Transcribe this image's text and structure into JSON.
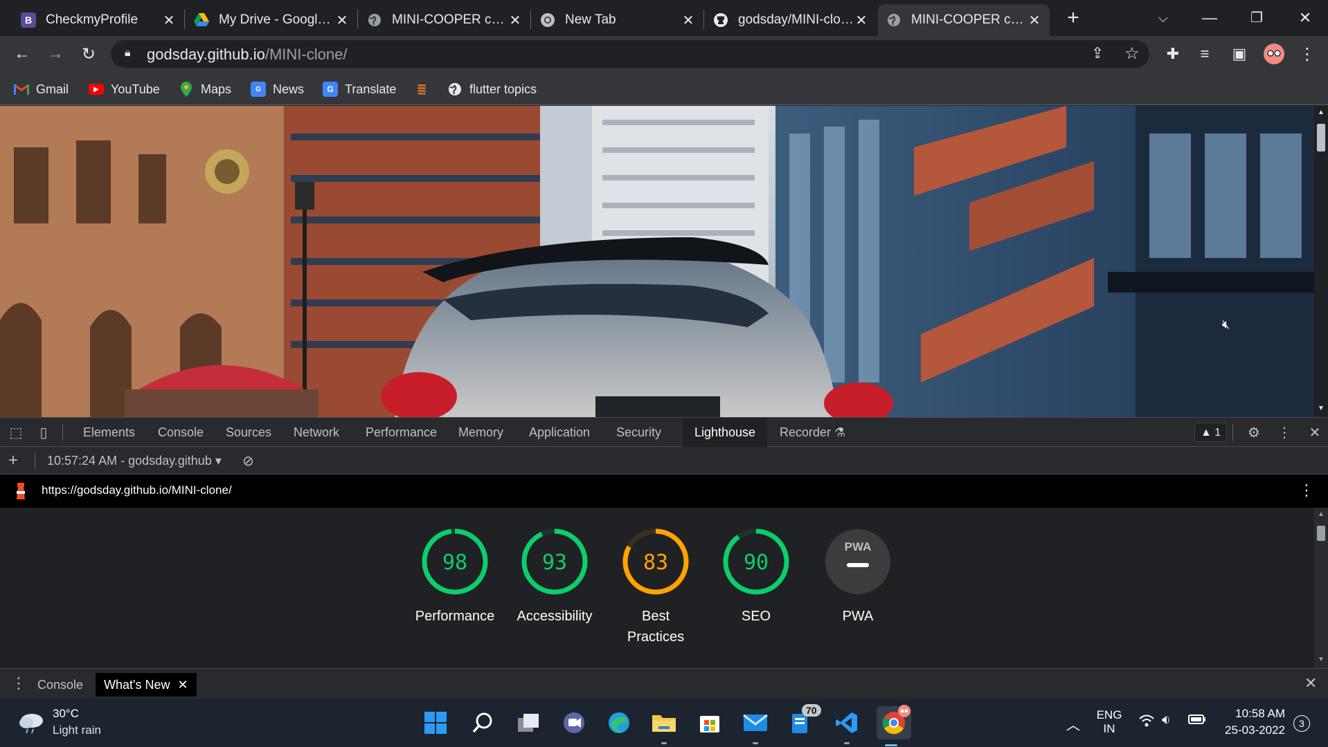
{
  "browser": {
    "tabs": [
      {
        "title": "CheckmyProfile",
        "icon": "b-logo-icon",
        "active": false
      },
      {
        "title": "My Drive - Google Drive",
        "icon": "google-drive-icon",
        "active": false
      },
      {
        "title": "MINI-COOPER configurator",
        "icon": "globe-icon",
        "active": false
      },
      {
        "title": "New Tab",
        "icon": "chrome-icon",
        "active": false
      },
      {
        "title": "godsday/MINI-clone",
        "icon": "github-icon",
        "active": false
      },
      {
        "title": "MINI-COOPER configurator",
        "icon": "globe-icon",
        "active": true
      }
    ],
    "new_tab_label": "+",
    "address": {
      "host": "godsday.github.io",
      "path": "/MINI-clone/"
    },
    "bookmarks": [
      {
        "label": "Gmail",
        "icon": "gmail-icon"
      },
      {
        "label": "YouTube",
        "icon": "youtube-icon"
      },
      {
        "label": "Maps",
        "icon": "maps-icon"
      },
      {
        "label": "News",
        "icon": "news-icon"
      },
      {
        "label": "Translate",
        "icon": "translate-icon"
      },
      {
        "label": "",
        "icon": "stack-icon"
      },
      {
        "label": "flutter topics",
        "icon": "globe-icon"
      }
    ]
  },
  "devtools": {
    "tabs": [
      "Elements",
      "Console",
      "Sources",
      "Network",
      "Performance",
      "Memory",
      "Application",
      "Security",
      "Lighthouse",
      "Recorder"
    ],
    "active_tab": "Lighthouse",
    "issues_count": "1",
    "report_selector": "10:57:24 AM - godsday.github",
    "report_url": "https://godsday.github.io/MINI-clone/",
    "scores": [
      {
        "label_line1": "Performance",
        "label_line2": "",
        "score": "98",
        "value": 98,
        "color": "#0cce6b",
        "pwa": false
      },
      {
        "label_line1": "Accessibility",
        "label_line2": "",
        "score": "93",
        "value": 93,
        "color": "#0cce6b",
        "pwa": false
      },
      {
        "label_line1": "Best",
        "label_line2": "Practices",
        "score": "83",
        "value": 83,
        "color": "#ffa400",
        "pwa": false
      },
      {
        "label_line1": "SEO",
        "label_line2": "",
        "score": "90",
        "value": 90,
        "color": "#0cce6b",
        "pwa": false
      },
      {
        "label_line1": "PWA",
        "label_line2": "",
        "score": "",
        "value": 0,
        "color": "#9aa0a6",
        "pwa": true,
        "badge_text": "PWA"
      }
    ],
    "drawer_tabs": [
      "Console",
      "What's New"
    ],
    "drawer_active": "What's New"
  },
  "taskbar": {
    "weather": {
      "temp": "30°C",
      "desc": "Light rain"
    },
    "apps": [
      {
        "name": "start-icon",
        "running": false
      },
      {
        "name": "search-icon",
        "running": false
      },
      {
        "name": "task-view-icon",
        "running": false
      },
      {
        "name": "teams-chat-icon",
        "running": false
      },
      {
        "name": "edge-icon",
        "running": false
      },
      {
        "name": "file-explorer-icon",
        "running": true
      },
      {
        "name": "microsoft-store-icon",
        "running": false
      },
      {
        "name": "mail-icon",
        "running": true
      },
      {
        "name": "todo-icon",
        "running": false,
        "badge": "70"
      },
      {
        "name": "vscode-icon",
        "running": true
      },
      {
        "name": "chrome-icon",
        "running": true,
        "focused": true
      }
    ],
    "lang_line1": "ENG",
    "lang_line2": "IN",
    "time": "10:58 AM",
    "date": "25-03-2022",
    "notification_count": "3"
  },
  "colors": {
    "good": "#0cce6b",
    "average": "#ffa400",
    "accent": "#1a73e8"
  }
}
